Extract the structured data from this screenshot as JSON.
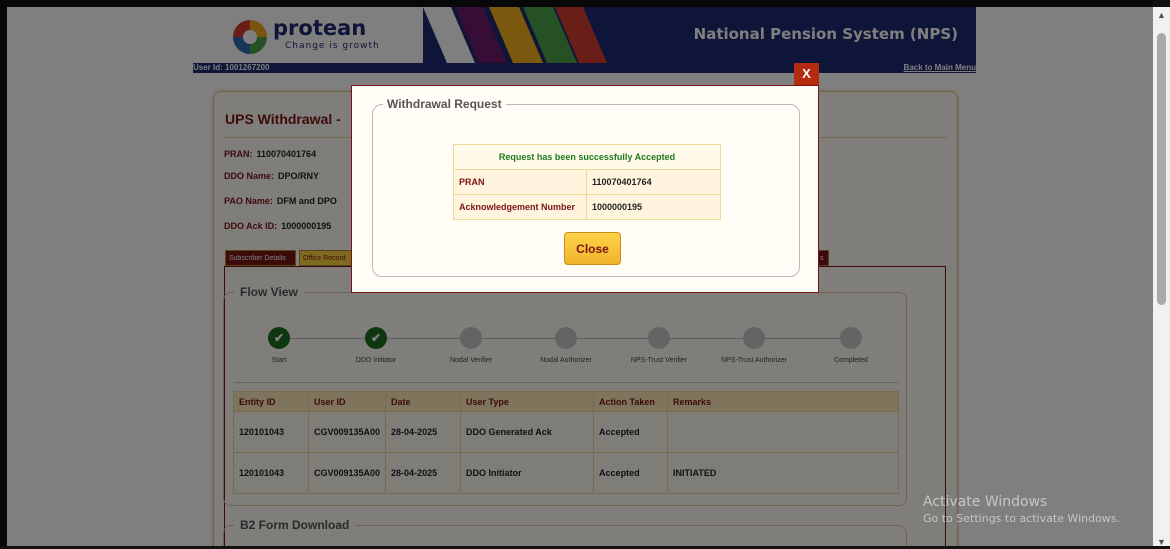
{
  "header": {
    "logo_name": "protean",
    "logo_tagline": "Change is growth",
    "title": "National Pension System (NPS)",
    "user_id": "User Id: 1001267200",
    "back_link": "Back to Main Menu"
  },
  "page": {
    "title": "UPS Withdrawal -",
    "info": [
      {
        "label": "PRAN:",
        "value": "110070401764"
      },
      {
        "label": "DDO Name:",
        "value": "DPO/RNY"
      },
      {
        "label": "PAO Name:",
        "value": "DFM and DPO"
      },
      {
        "label": "DDO Ack ID:",
        "value": "1000000195"
      }
    ],
    "tabs": [
      "Subscriber Details",
      "Office Record",
      "s"
    ]
  },
  "flow": {
    "legend": "Flow View",
    "steps": [
      {
        "label": "Start",
        "done": true
      },
      {
        "label": "DDO Initiator",
        "done": true
      },
      {
        "label": "Nodal Verifier",
        "done": false
      },
      {
        "label": "Nodal Authorizer",
        "done": false
      },
      {
        "label": "NPS-Trust Verifier",
        "done": false
      },
      {
        "label": "NPS-Trust Authorizer",
        "done": false
      },
      {
        "label": "Completed",
        "done": false
      }
    ],
    "table": {
      "headers": [
        "Entity ID",
        "User ID",
        "Date",
        "User Type",
        "Action Taken",
        "Remarks"
      ],
      "rows": [
        [
          "120101043",
          "CGV009135A00",
          "28-04-2025",
          "DDO Generated Ack",
          "Accepted",
          ""
        ],
        [
          "120101043",
          "CGV009135A00",
          "28-04-2025",
          "DDO Initiator",
          "Accepted",
          "INITIATED"
        ]
      ]
    }
  },
  "b2": {
    "legend": "B2 Form Download"
  },
  "modal": {
    "close_x": "X",
    "legend": "Withdrawal Request",
    "message": "Request has been successfully Accepted",
    "rows": [
      {
        "label": "PRAN",
        "value": "110070401764"
      },
      {
        "label": "Acknowledgement Number",
        "value": "1000000195"
      }
    ],
    "close_button": "Close"
  },
  "watermark": {
    "line1": "Activate Windows",
    "line2": "Go to Settings to activate Windows."
  },
  "colors": {
    "brand_navy": "#1e2a72",
    "maroon": "#7a1414",
    "gold": "#ffd640",
    "success_green": "#1e7a1e"
  }
}
